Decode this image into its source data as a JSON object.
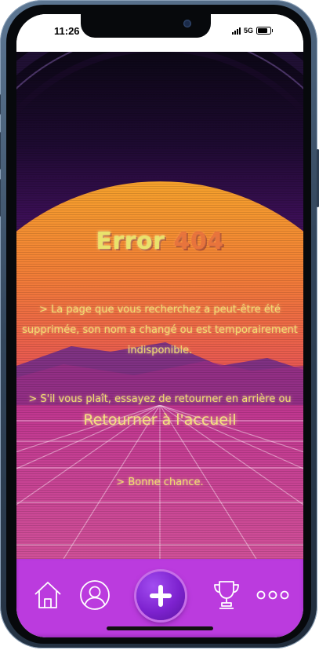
{
  "status_bar": {
    "time": "11:26",
    "network": "5G"
  },
  "error_page": {
    "title_word": "Error",
    "title_code": "404",
    "message_1": "> La page que vous recherchez a peut-être été supprimée, son nom a changé ou est temporairement indisponible.",
    "message_2_prefix": "> S'il vous plaît, essayez de retourner en arrière ou",
    "home_link_label": "Retourner à l'accueil",
    "message_3": "> Bonne chance."
  },
  "colors": {
    "text_yellow": "#f3dc72",
    "title_orange": "#e8743c",
    "tabbar_purple": "#bb3bde",
    "add_button_purple": "#7d22cf"
  },
  "tabbar": {
    "items": [
      {
        "icon": "home-icon"
      },
      {
        "icon": "user-icon"
      },
      {
        "icon": "plus-icon"
      },
      {
        "icon": "trophy-icon"
      },
      {
        "icon": "more-icon"
      }
    ]
  }
}
